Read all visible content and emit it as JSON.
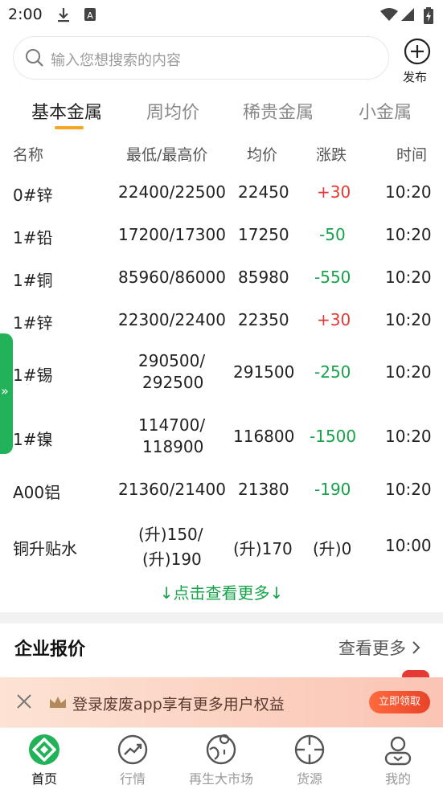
{
  "status_bar": {
    "time": "2:00",
    "icons": [
      "download-icon",
      "keyboard-a-icon",
      "wifi-icon",
      "signal-icon",
      "battery-charging-icon"
    ]
  },
  "search": {
    "placeholder": "输入您想搜索的内容"
  },
  "publish": {
    "label": "发布"
  },
  "tabs": [
    {
      "label": "基本金属",
      "active": true
    },
    {
      "label": "周均价",
      "active": false
    },
    {
      "label": "稀贵金属",
      "active": false
    },
    {
      "label": "小金属",
      "active": false
    }
  ],
  "table": {
    "headers": [
      "名称",
      "最低/最高价",
      "均价",
      "涨跌",
      "时间"
    ],
    "rows": [
      {
        "name": "0#锌",
        "range": [
          "22400/22500"
        ],
        "avg": "22450",
        "change": "+30",
        "direction": "up",
        "time": "10:20"
      },
      {
        "name": "1#铅",
        "range": [
          "17200/17300"
        ],
        "avg": "17250",
        "change": "-50",
        "direction": "down",
        "time": "10:20"
      },
      {
        "name": "1#铜",
        "range": [
          "85960/86000"
        ],
        "avg": "85980",
        "change": "-550",
        "direction": "down",
        "time": "10:20"
      },
      {
        "name": "1#锌",
        "range": [
          "22300/22400"
        ],
        "avg": "22350",
        "change": "+30",
        "direction": "up",
        "time": "10:20"
      },
      {
        "name": "1#锡",
        "range": [
          "290500/",
          "292500"
        ],
        "avg": "291500",
        "change": "-250",
        "direction": "down",
        "time": "10:20"
      },
      {
        "name": "1#镍",
        "range": [
          "114700/",
          "118900"
        ],
        "avg": "116800",
        "change": "-1500",
        "direction": "down",
        "time": "10:20"
      },
      {
        "name": "A00铝",
        "range": [
          "21360/21400"
        ],
        "avg": "21380",
        "change": "-190",
        "direction": "down",
        "time": "10:20"
      },
      {
        "name": "铜升贴水",
        "range": [
          "(升)150/",
          "(升)190"
        ],
        "avg": "(升)170",
        "change": "(升)0",
        "direction": "flat",
        "time": "10:00"
      }
    ]
  },
  "more_link": "↓点击查看更多↓",
  "enterprise": {
    "title": "企业报价",
    "more": "查看更多"
  },
  "promo": {
    "text": "登录废废app享有更多用户权益",
    "button": "立即领取"
  },
  "bottom_nav": [
    {
      "label": "首页",
      "icon": "home-icon",
      "active": true
    },
    {
      "label": "行情",
      "icon": "trend-icon",
      "active": false
    },
    {
      "label": "再生大市场",
      "icon": "market-map-icon",
      "active": false
    },
    {
      "label": "货源",
      "icon": "target-icon",
      "active": false
    },
    {
      "label": "我的",
      "icon": "profile-icon",
      "active": false
    }
  ],
  "colors": {
    "up": "#e53935",
    "down": "#16a34a",
    "accent": "#22b35a",
    "tab_indicator": "#f5a623"
  }
}
